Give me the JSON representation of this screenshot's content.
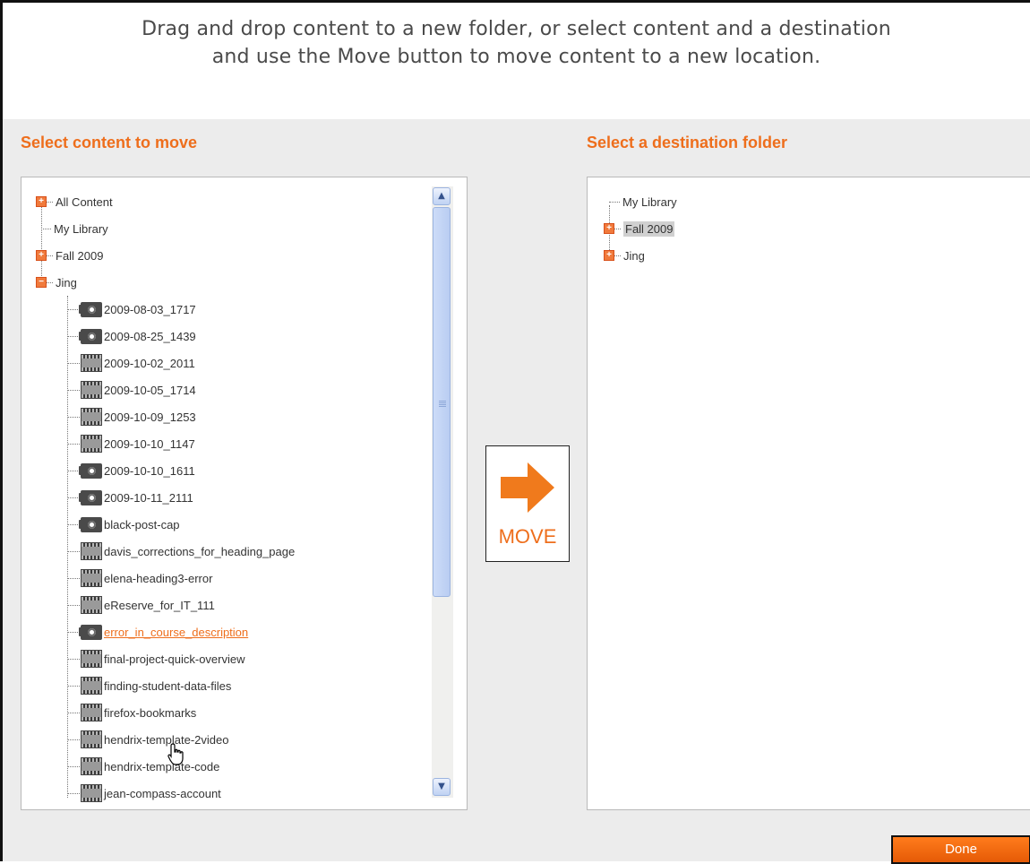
{
  "header": {
    "instructions_line1": "Drag and drop content to a new folder, or select content and a destination",
    "instructions_line2": "and use the Move button to move content to a new location."
  },
  "left_panel": {
    "title": "Select content to move",
    "roots": [
      {
        "label": "All Content",
        "expander": "+"
      },
      {
        "label": "My Library",
        "expander": ""
      },
      {
        "label": "Fall 2009",
        "expander": "+"
      },
      {
        "label": "Jing",
        "expander": "−"
      }
    ],
    "items": [
      {
        "label": "2009-08-03_1717",
        "icon": "camera-icon"
      },
      {
        "label": "2009-08-25_1439",
        "icon": "camera-icon"
      },
      {
        "label": "2009-10-02_2011",
        "icon": "film-icon"
      },
      {
        "label": "2009-10-05_1714",
        "icon": "film-icon"
      },
      {
        "label": "2009-10-09_1253",
        "icon": "film-icon"
      },
      {
        "label": "2009-10-10_1147",
        "icon": "film-icon"
      },
      {
        "label": "2009-10-10_1611",
        "icon": "camera-icon"
      },
      {
        "label": "2009-10-11_2111",
        "icon": "camera-icon"
      },
      {
        "label": "black-post-cap",
        "icon": "camera-icon"
      },
      {
        "label": "davis_corrections_for_heading_page",
        "icon": "film-icon"
      },
      {
        "label": "elena-heading3-error",
        "icon": "film-icon"
      },
      {
        "label": "eReserve_for_IT_111",
        "icon": "film-icon"
      },
      {
        "label": "error_in_course_description",
        "icon": "camera-icon",
        "selected": true
      },
      {
        "label": "final-project-quick-overview",
        "icon": "film-icon"
      },
      {
        "label": "finding-student-data-files",
        "icon": "film-icon"
      },
      {
        "label": "firefox-bookmarks",
        "icon": "film-icon"
      },
      {
        "label": "hendrix-template-2video",
        "icon": "film-icon"
      },
      {
        "label": "hendrix-template-code",
        "icon": "film-icon"
      },
      {
        "label": "jean-compass-account",
        "icon": "film-icon"
      }
    ]
  },
  "move_button": {
    "label": "MOVE",
    "accent": "#f07a1c"
  },
  "right_panel": {
    "title": "Select a destination folder",
    "items": [
      {
        "label": "My Library",
        "expander": ""
      },
      {
        "label": "Fall 2009",
        "expander": "+",
        "highlighted": true
      },
      {
        "label": "Jing",
        "expander": "+"
      }
    ]
  },
  "footer": {
    "done_label": "Done"
  },
  "colors": {
    "accent": "#ee6e1c",
    "panel_bg": "#ececec"
  }
}
